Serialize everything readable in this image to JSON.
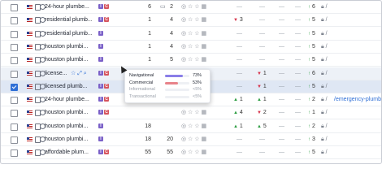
{
  "rows": [
    {
      "kw": "24-hour plumbe...",
      "intents": [
        "I",
        "C"
      ],
      "vol": "6",
      "kd": "2",
      "serp_count": "",
      "pos": "",
      "pos_dir": "",
      "c2": "",
      "c3": "—",
      "c4": "—",
      "c5": "6",
      "last": "",
      "state": "normal"
    },
    {
      "kw": "residential plumb...",
      "intents": [
        "I",
        "C"
      ],
      "vol": "1",
      "kd": "4",
      "serp_count": "",
      "pos": "3",
      "pos_dir": "down",
      "c2": "",
      "c3": "—",
      "c4": "—",
      "c5": "5",
      "last": "",
      "state": "normal"
    },
    {
      "kw": "residential plumb...",
      "intents": [
        "I"
      ],
      "vol": "1",
      "kd": "4",
      "serp_count": "",
      "pos": "",
      "pos_dir": "",
      "c2": "",
      "c3": "—",
      "c4": "—",
      "c5": "5",
      "last": "",
      "state": "normal"
    },
    {
      "kw": "houston plumbi...",
      "intents": [
        "I"
      ],
      "vol": "1",
      "kd": "4",
      "serp_count": "",
      "pos": "",
      "pos_dir": "",
      "c2": "",
      "c3": "—",
      "c4": "—",
      "c5": "5",
      "last": "",
      "state": "normal"
    },
    {
      "kw": "houston plumbi...",
      "intents": [
        "I"
      ],
      "vol": "1",
      "kd": "5",
      "serp_count": "",
      "pos": "",
      "pos_dir": "",
      "c2": "",
      "c3": "—",
      "c4": "—",
      "c5": "5",
      "last": "",
      "state": "normal"
    },
    {
      "kw": "license...",
      "intents": [
        "I",
        "C"
      ],
      "vol": "3",
      "kd": "8",
      "serp_count": "",
      "pos": "",
      "pos_dir": "",
      "c2": "1",
      "c2_dir": "down",
      "c3": "—",
      "c4": "—",
      "c5": "6",
      "last": "",
      "state": "hl"
    },
    {
      "kw": "licensed plumb...",
      "intents": [
        "I",
        "C"
      ],
      "vol": "",
      "kd": "",
      "serp_count": "",
      "pos": "",
      "pos_dir": "",
      "c2": "1",
      "c2_dir": "down",
      "c3": "—",
      "c4": "—",
      "c5": "5",
      "last": "",
      "state": "sel"
    },
    {
      "kw": "24-hour plumbe...",
      "intents": [
        "I",
        "C"
      ],
      "vol": "",
      "kd": "",
      "serp_count": "",
      "pos": "1",
      "pos_dir": "up",
      "c2": "1",
      "c2_dir": "up",
      "c3": "—",
      "c4": "—",
      "c5": "2",
      "last": "/emergency-plumber...",
      "state": "normal"
    },
    {
      "kw": "houston plumbi...",
      "intents": [
        "I",
        "C"
      ],
      "vol": "",
      "kd": "",
      "serp_count": "",
      "pos": "4",
      "pos_dir": "up",
      "c2": "2",
      "c2_dir": "down",
      "c3": "—",
      "c4": "—",
      "c5": "1",
      "last": "",
      "state": "normal"
    },
    {
      "kw": "houston plumbi...",
      "intents": [
        "I"
      ],
      "vol": "18",
      "kd": "",
      "serp_count": "",
      "pos": "1",
      "pos_dir": "up",
      "c2": "5",
      "c2_dir": "up",
      "c3": "—",
      "c4": "—",
      "c5": "2",
      "last": "",
      "state": "normal"
    },
    {
      "kw": "houston plumbi...",
      "intents": [
        "I"
      ],
      "vol": "18",
      "kd": "20",
      "serp_count": "",
      "pos": "",
      "pos_dir": "",
      "c2": "",
      "c3": "—",
      "c4": "—",
      "c5": "3",
      "last": "",
      "state": "normal"
    },
    {
      "kw": "affordable plum...",
      "intents": [
        "I",
        "C"
      ],
      "vol": "55",
      "kd": "55",
      "serp_count": "",
      "pos": "",
      "pos_dir": "",
      "c2": "",
      "c3": "—",
      "c4": "—",
      "c5": "5",
      "last": "",
      "state": "normal"
    }
  ],
  "first_row_serp": "1",
  "tooltip": {
    "items": [
      {
        "label": "Navigational",
        "pct": "73%",
        "fraction": 0.73,
        "color": "#8a7ee8",
        "muted": false
      },
      {
        "label": "Commercial",
        "pct": "53%",
        "fraction": 0.53,
        "color": "#e8838a",
        "muted": false
      },
      {
        "label": "Informational",
        "pct": "<5%",
        "fraction": 0.0,
        "color": "#cfd3da",
        "muted": true
      },
      {
        "label": "Transactional",
        "pct": "<5%",
        "fraction": 0.0,
        "color": "#cfd3da",
        "muted": true
      }
    ]
  }
}
